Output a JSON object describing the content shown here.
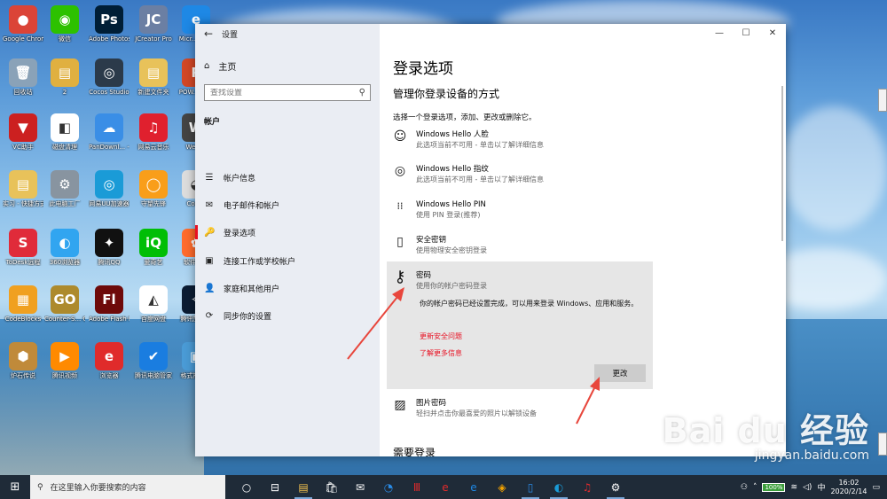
{
  "desktop": {
    "icons": [
      {
        "label": "Google Chrome",
        "glyph": "●",
        "color": "#db4437"
      },
      {
        "label": "微信",
        "glyph": "◉",
        "color": "#2dc100"
      },
      {
        "label": "Adobe Photosh...",
        "glyph": "Ps",
        "color": "#001e36"
      },
      {
        "label": "JCreator Pro",
        "glyph": "JC",
        "color": "#6b7fa3"
      },
      {
        "label": "Micr... Ed...",
        "glyph": "e",
        "color": "#1e88e5"
      },
      {
        "label": "回收站",
        "glyph": "🗑",
        "color": "#8aa2b8"
      },
      {
        "label": "2",
        "glyph": "▤",
        "color": "#e0b040"
      },
      {
        "label": "Cocos Studio",
        "glyph": "◎",
        "color": "#2b3a4a"
      },
      {
        "label": "新建文件夹",
        "glyph": "▤",
        "color": "#e8c25a"
      },
      {
        "label": "POW... 文...",
        "glyph": "P",
        "color": "#d24726"
      },
      {
        "label": "VC助手",
        "glyph": "▼",
        "color": "#cc2020"
      },
      {
        "label": "磁盘清理",
        "glyph": "◧",
        "color": "#ffffff"
      },
      {
        "label": "PanDownl... - 快捷方式",
        "glyph": "☁",
        "color": "#3a8ee6"
      },
      {
        "label": "网易云音乐",
        "glyph": "♫",
        "color": "#e0202e"
      },
      {
        "label": "WeG...",
        "glyph": "W",
        "color": "#444"
      },
      {
        "label": "实习 - 快捷方式",
        "glyph": "▤",
        "color": "#e8c25a"
      },
      {
        "label": "此电脑工厂",
        "glyph": "⚙",
        "color": "#8894a0"
      },
      {
        "label": "网易UU加速器",
        "glyph": "◎",
        "color": "#1a9bd7"
      },
      {
        "label": "守望先锋",
        "glyph": "◯",
        "color": "#f99e1a"
      },
      {
        "label": "Cocos",
        "glyph": "◕",
        "color": "#dddddd"
      },
      {
        "label": "ToDesk远程",
        "glyph": "S",
        "color": "#e02b3a"
      },
      {
        "label": "360浏览器",
        "glyph": "◐",
        "color": "#31a5f0"
      },
      {
        "label": "腾讯QQ",
        "glyph": "✦",
        "color": "#111"
      },
      {
        "label": "爱奇艺",
        "glyph": "iQ",
        "color": "#00be06"
      },
      {
        "label": "软件管家",
        "glyph": "✿",
        "color": "#ff6b2c"
      },
      {
        "label": "CodeBlocks",
        "glyph": "▦",
        "color": "#f0a020"
      },
      {
        "label": "Counter-S... Global Off...",
        "glyph": "GO",
        "color": "#ad8a2d"
      },
      {
        "label": "Adobe Flash Profession...",
        "glyph": "Fl",
        "color": "#6e0a0a"
      },
      {
        "label": "百度网盘",
        "glyph": "◭",
        "color": "#ffffff"
      },
      {
        "label": "腾讯加速器",
        "glyph": "✧",
        "color": "#0b1c33"
      },
      {
        "label": "炉石传说",
        "glyph": "⬢",
        "color": "#c08a3a"
      },
      {
        "label": "腾讯视频",
        "glyph": "▶",
        "color": "#ff8a00"
      },
      {
        "label": "浏览器",
        "glyph": "e",
        "color": "#e02b2b"
      },
      {
        "label": "腾讯电脑管家",
        "glyph": "✔",
        "color": "#1a7de0"
      },
      {
        "label": "格式播放器",
        "glyph": "▣",
        "color": "#4a9bd6"
      }
    ]
  },
  "window": {
    "app_title": "设置",
    "controls": {
      "minimize": "—",
      "maximize": "☐",
      "close": "✕"
    },
    "nav": {
      "back": "←",
      "home": "主页",
      "search_placeholder": "查找设置",
      "section": "帐户",
      "items": [
        {
          "label": "帐户信息",
          "icon": "☰"
        },
        {
          "label": "电子邮件和帐户",
          "icon": "✉"
        },
        {
          "label": "登录选项",
          "icon": "🔑"
        },
        {
          "label": "连接工作或学校帐户",
          "icon": "▣"
        },
        {
          "label": "家庭和其他用户",
          "icon": "👤"
        },
        {
          "label": "同步你的设置",
          "icon": "⟳"
        }
      ]
    },
    "content": {
      "heading": "登录选项",
      "subheading": "管理你登录设备的方式",
      "description": "选择一个登录选项，添加、更改或删除它。",
      "options": [
        {
          "title": "Windows Hello 人脸",
          "sub": "此选项当前不可用 - 单击以了解详细信息",
          "icon": "☺"
        },
        {
          "title": "Windows Hello 指纹",
          "sub": "此选项当前不可用 - 单击以了解详细信息",
          "icon": "◎"
        },
        {
          "title": "Windows Hello PIN",
          "sub": "使用 PIN 登录(推荐)",
          "icon": "⁞⁞"
        },
        {
          "title": "安全密钥",
          "sub": "使用物理安全密钥登录",
          "icon": "▯"
        },
        {
          "title": "密码",
          "sub": "使用你的帐户密码登录",
          "icon": "⚷"
        },
        {
          "title": "图片密码",
          "sub": "轻扫并点击你最喜爱的照片以解锁设备",
          "icon": "▨"
        }
      ],
      "password_body": "你的帐户密码已经设置完成，可以用来登录 Windows、应用和服务。",
      "link_update_security": "更新安全问题",
      "link_learn_more": "了解更多信息",
      "change_button": "更改",
      "next_section": "需要登录"
    }
  },
  "taskbar": {
    "start_icon": "⊞",
    "search_placeholder": "在这里输入你要搜索的内容",
    "apps": [
      "○",
      "⊟",
      "▤",
      "🛍",
      "✉",
      "◔",
      "Ⅲ",
      "e",
      "e",
      "◈",
      "▯",
      "◐",
      "♫",
      "⚙"
    ],
    "battery": "100%",
    "time": "16:02",
    "date": "2020/2/14"
  },
  "watermark": {
    "big": "Bai du 经验",
    "small": "jingyan.baidu.com"
  }
}
